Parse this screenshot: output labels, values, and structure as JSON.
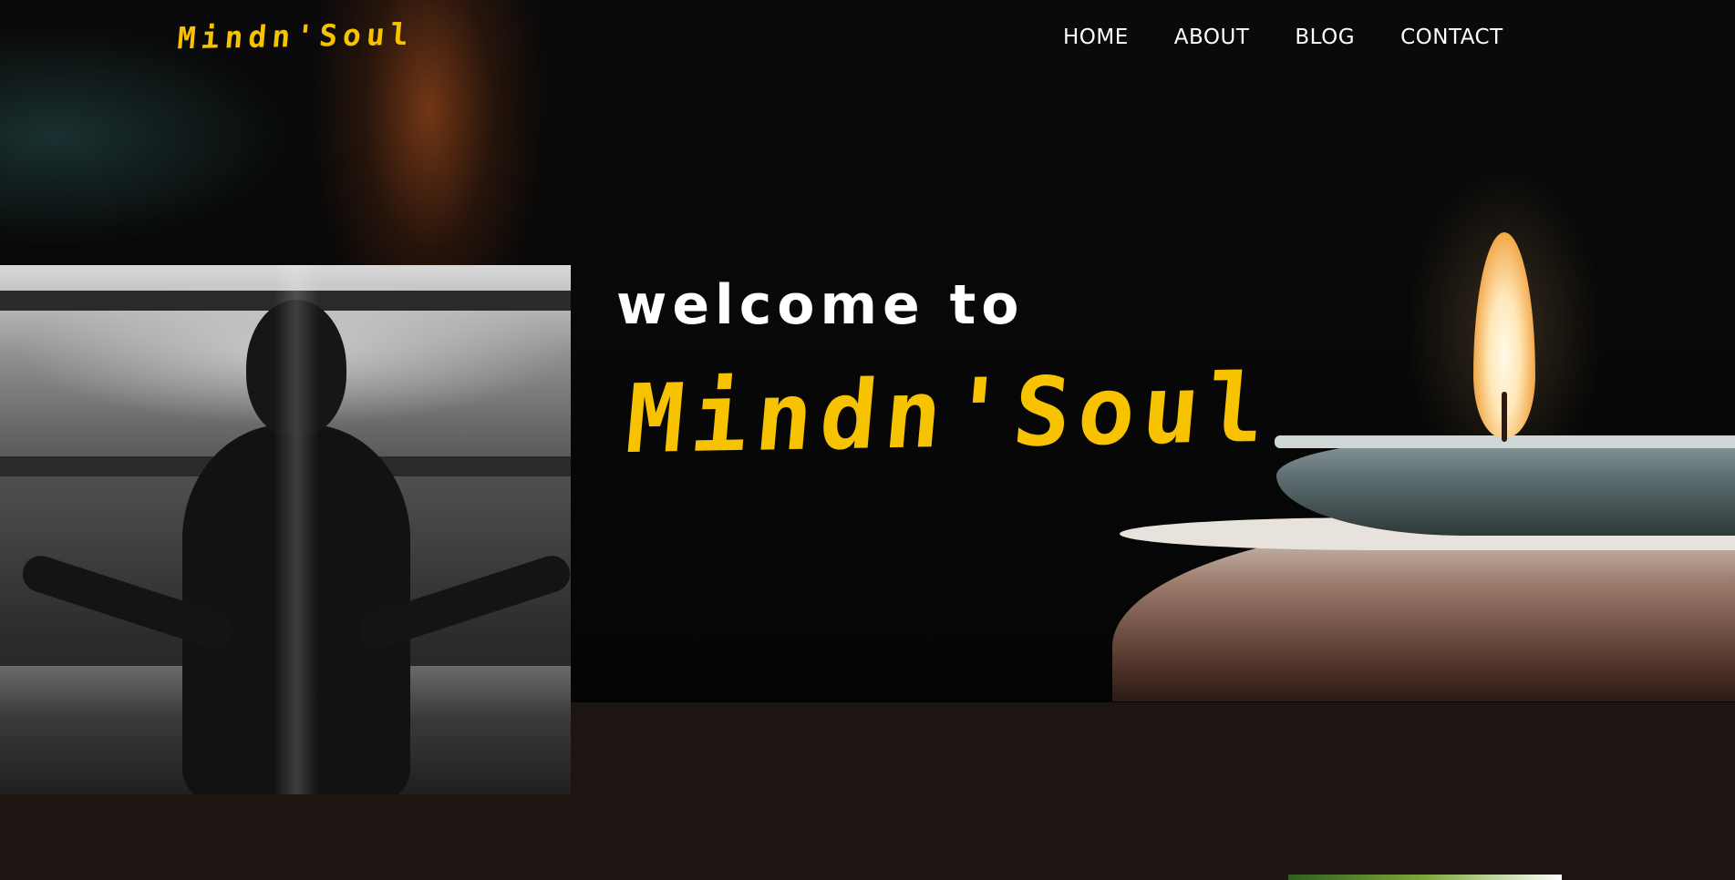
{
  "brand": {
    "logo_text": "Mindn'Soul"
  },
  "nav": {
    "items": [
      {
        "label": "HOME"
      },
      {
        "label": "ABOUT"
      },
      {
        "label": "BLOG"
      },
      {
        "label": "CONTACT"
      }
    ]
  },
  "hero": {
    "welcome_text": "welcome to",
    "title": "Mindn'Soul"
  },
  "colors": {
    "accent": "#f7c200",
    "text_light": "#ffffff",
    "page_bg": "#1d1512",
    "hero_bg": "#050505"
  }
}
